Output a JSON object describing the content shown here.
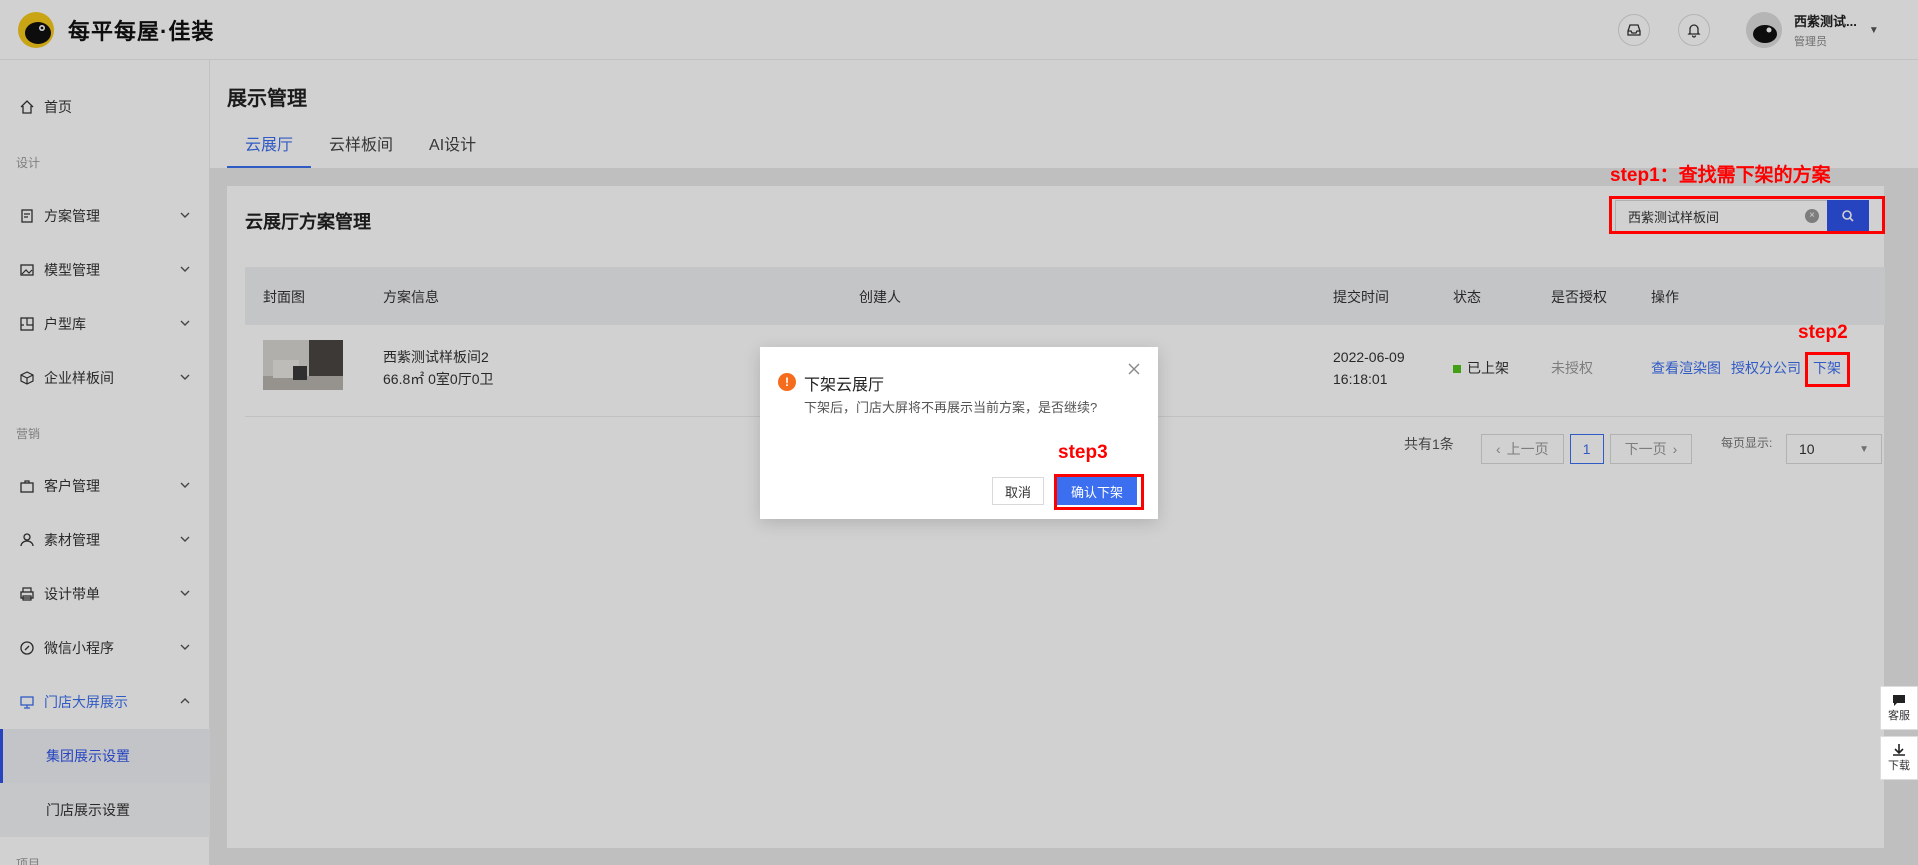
{
  "brand": {
    "name": "每平每屋·佳装"
  },
  "user": {
    "name": "西紫测试...",
    "role": "管理员"
  },
  "sidebar": {
    "home": "首页",
    "section_design": "设计",
    "items_design": [
      "方案管理",
      "模型管理",
      "户型库",
      "企业样板间"
    ],
    "section_marketing": "营销",
    "items_marketing": [
      "客户管理",
      "素材管理",
      "设计带单",
      "微信小程序"
    ],
    "store_display": "门店大屏展示",
    "sub_items": [
      "集团展示设置",
      "门店展示设置"
    ],
    "section_project": "项目"
  },
  "page": {
    "title": "展示管理",
    "tabs": [
      "云展厅",
      "云样板间",
      "AI设计"
    ]
  },
  "card": {
    "title": "云展厅方案管理",
    "search_value": "西紫测试样板间"
  },
  "table": {
    "headers": [
      "封面图",
      "方案信息",
      "创建人",
      "提交时间",
      "状态",
      "是否授权",
      "操作"
    ],
    "row": {
      "name": "西紫测试样板间2",
      "info": "66.8㎡ 0室0厅0卫",
      "date": "2022-06-09",
      "time": "16:18:01",
      "status": "已上架",
      "auth": "未授权",
      "actions": [
        "查看渲染图",
        "授权分公司",
        "下架"
      ]
    }
  },
  "pager": {
    "total": "共有1条",
    "prev": "上一页",
    "page": "1",
    "next": "下一页",
    "per_page_label": "每页显示:",
    "per_page": "10"
  },
  "dialog": {
    "title": "下架云展厅",
    "body": "下架后，门店大屏将不再展示当前方案，是否继续?",
    "cancel": "取消",
    "confirm": "确认下架"
  },
  "annotations": {
    "step1": "step1：查找需下架的方案",
    "step2": "step2",
    "step3": "step3"
  },
  "floating": {
    "service": "客服",
    "download": "下载"
  },
  "colors": {
    "accent": "#3c6ff0",
    "annotation": "#ff0000",
    "warning": "#f56c1d",
    "status_on": "#52c41a"
  }
}
